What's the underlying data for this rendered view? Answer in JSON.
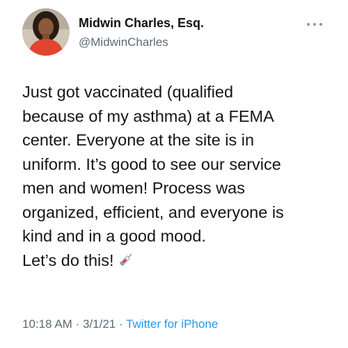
{
  "author": {
    "name": "Midwin Charles, Esq.",
    "handle": "@MidwinCharles"
  },
  "tweet": {
    "lines": [
      "Just got vaccinated (qualified",
      "because of my asthma) at a FEMA",
      "center. Everyone at the site is in",
      "uniform. It’s good to see our service",
      "men and women! Process was",
      "organized, efficient, and everyone is",
      "kind and in a good mood.",
      "Let’s do this!"
    ],
    "emoji": "syringe-icon"
  },
  "meta": {
    "time": "10:18 AM",
    "date": "3/1/21",
    "separator": "·",
    "source": "Twitter for iPhone"
  },
  "colors": {
    "link": "#1d9bf0",
    "secondary_text": "#5d6a74",
    "avatar_shirt": "#e2452f"
  },
  "icons": [
    "more-options-icon",
    "syringe-icon"
  ]
}
